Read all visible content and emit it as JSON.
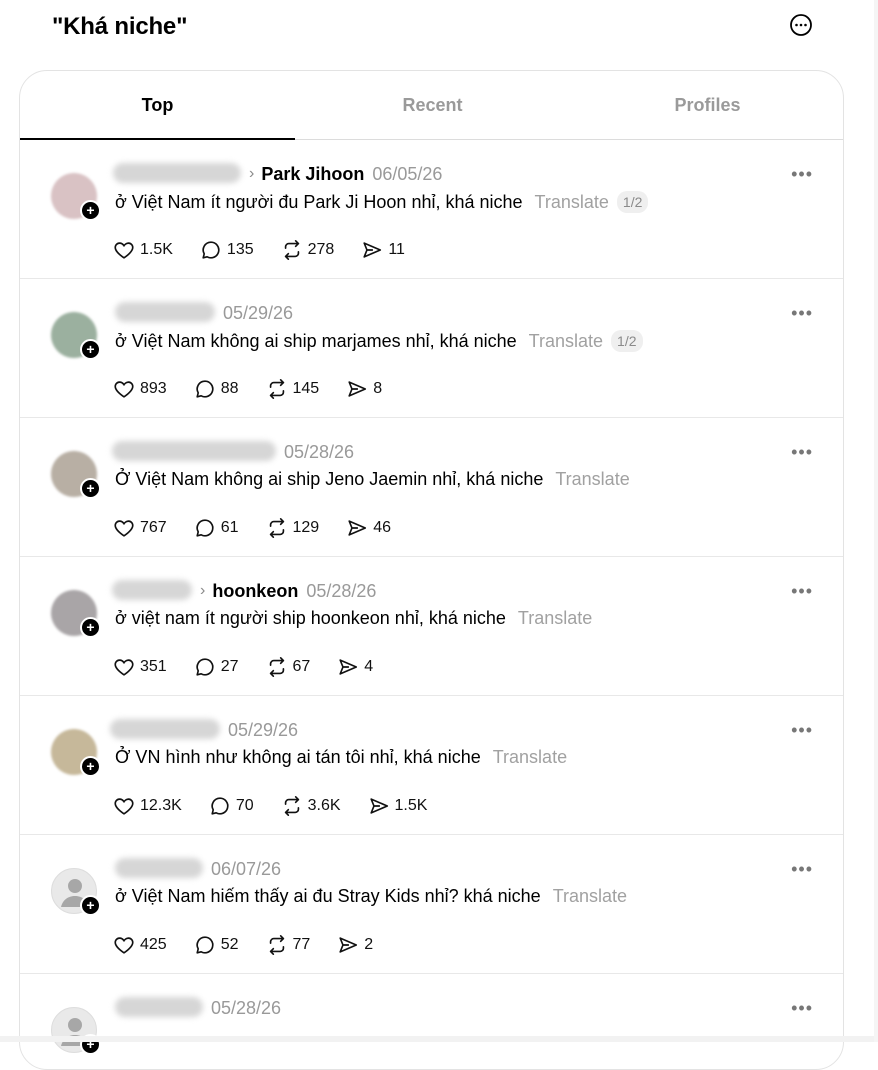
{
  "header": {
    "title": "\"Khá niche\"",
    "more_icon": "more-circle-icon"
  },
  "tabs": [
    {
      "label": "Top",
      "active": true
    },
    {
      "label": "Recent",
      "active": false
    },
    {
      "label": "Profiles",
      "active": false
    }
  ],
  "posts": [
    {
      "target": "Park Jihoon",
      "date": "06/05/26",
      "text": "ở Việt Nam ít người đu Park Ji Hoon nhỉ, khá niche",
      "translate": "Translate",
      "pager": "1/2",
      "likes": "1.5K",
      "replies": "135",
      "reposts": "278",
      "shares": "11"
    },
    {
      "target": "",
      "date": "05/29/26",
      "text": "ở Việt Nam không ai ship marjames nhỉ, khá niche",
      "translate": "Translate",
      "pager": "1/2",
      "likes": "893",
      "replies": "88",
      "reposts": "145",
      "shares": "8"
    },
    {
      "target": "",
      "date": "05/28/26",
      "text": "Ở Việt Nam không ai ship Jeno Jaemin nhỉ, khá niche",
      "translate": "Translate",
      "pager": "",
      "likes": "767",
      "replies": "61",
      "reposts": "129",
      "shares": "46"
    },
    {
      "target": "hoonkeon",
      "date": "05/28/26",
      "text": "ở việt nam ít người ship hoonkeon nhỉ, khá niche",
      "translate": "Translate",
      "pager": "",
      "likes": "351",
      "replies": "27",
      "reposts": "67",
      "shares": "4"
    },
    {
      "target": "",
      "date": "05/29/26",
      "text": "Ở VN hình như không ai tán tôi nhỉ, khá niche",
      "translate": "Translate",
      "pager": "",
      "likes": "12.3K",
      "replies": "70",
      "reposts": "3.6K",
      "shares": "1.5K"
    },
    {
      "target": "",
      "date": "06/07/26",
      "text": "ở Việt Nam hiếm thấy ai đu Stray Kids nhỉ? khá niche",
      "translate": "Translate",
      "pager": "",
      "likes": "425",
      "replies": "52",
      "reposts": "77",
      "shares": "2"
    },
    {
      "target": "",
      "date": "05/28/26",
      "text": "",
      "translate": "",
      "pager": "",
      "likes": "",
      "replies": "",
      "reposts": "",
      "shares": ""
    }
  ],
  "more_dots": "•••"
}
